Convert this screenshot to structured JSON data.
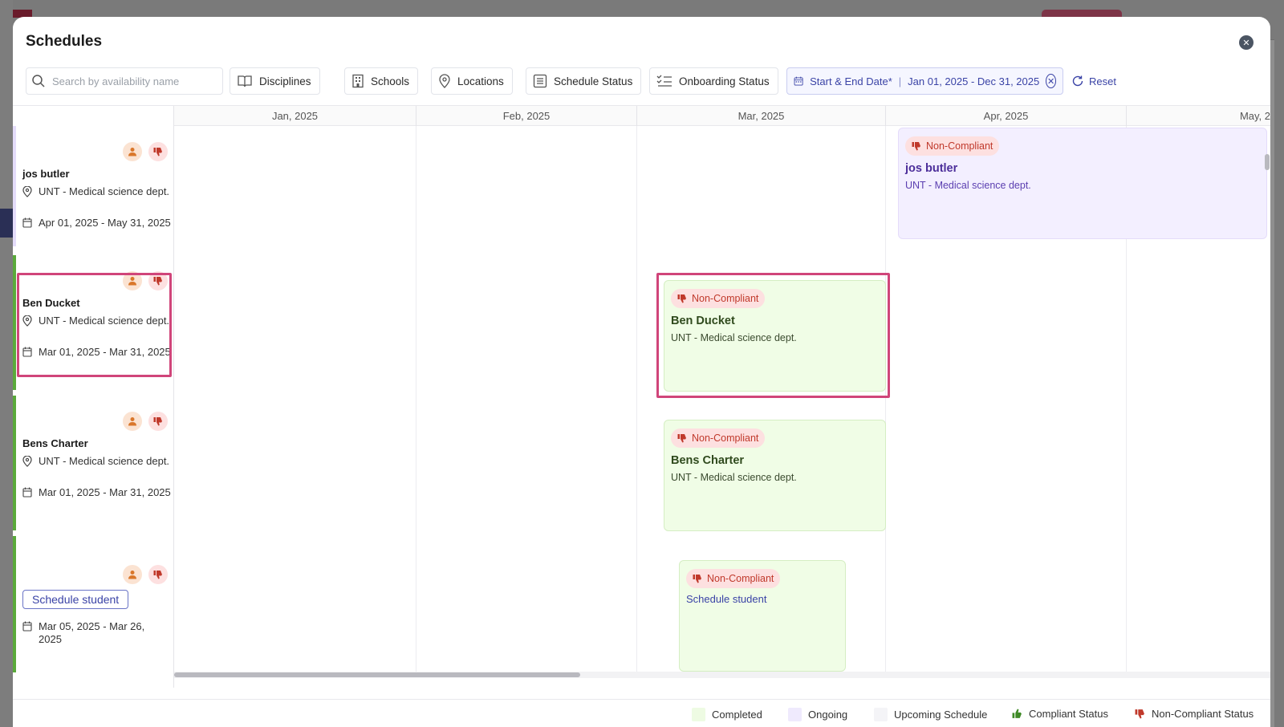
{
  "modal": {
    "title": "Schedules",
    "close_icon": "close-icon"
  },
  "filters": {
    "search_placeholder": "Search by availability name",
    "disciplines": "Disciplines",
    "schools": "Schools",
    "locations": "Locations",
    "schedule_status": "Schedule Status",
    "onboarding_status": "Onboarding Status",
    "date_label": "Start & End Date*",
    "date_separator": "|",
    "date_range": "Jan 01, 2025 - Dec 31, 2025",
    "reset": "Reset"
  },
  "months": [
    "Jan, 2025",
    "Feb, 2025",
    "Mar, 2025",
    "Apr, 2025",
    "May, 2"
  ],
  "rows": [
    {
      "name": "jos butler",
      "location": "UNT - Medical science dept.",
      "dates": "Apr 01, 2025 - May 31, 2025",
      "status_color": "#e4dcfa"
    },
    {
      "name": "Ben Ducket",
      "location": "UNT - Medical science dept.",
      "dates": "Mar 01, 2025 - Mar 31, 2025",
      "status_color": "#5aaa3a"
    },
    {
      "name": "Bens  Charter",
      "location": "UNT - Medical science dept.",
      "dates": "Mar 01, 2025 - Mar 31, 2025",
      "status_color": "#5aaa3a"
    },
    {
      "action": "Schedule student",
      "dates": "Mar 05, 2025 - Mar 26, 2025",
      "status_color": "#5aaa3a"
    }
  ],
  "events": [
    {
      "badge": "Non-Compliant",
      "name": "jos butler",
      "dept": "UNT - Medical science dept.",
      "style": "purple"
    },
    {
      "badge": "Non-Compliant",
      "name": "Ben Ducket",
      "dept": "UNT - Medical science dept.",
      "style": "green"
    },
    {
      "badge": "Non-Compliant",
      "name": "Bens  Charter",
      "dept": "UNT - Medical science dept.",
      "style": "green"
    },
    {
      "badge": "Non-Compliant",
      "link": "Schedule student",
      "style": "green"
    }
  ],
  "legend": {
    "completed": "Completed",
    "ongoing": "Ongoing",
    "upcoming": "Upcoming Schedule",
    "compliant": "Compliant Status",
    "non_compliant": "Non-Compliant Status",
    "colors": {
      "completed": "#eefbe3",
      "ongoing": "#efeafd",
      "upcoming": "#f4f4f7",
      "compliant": "#3f8a26",
      "non_compliant": "#c0392b"
    }
  }
}
